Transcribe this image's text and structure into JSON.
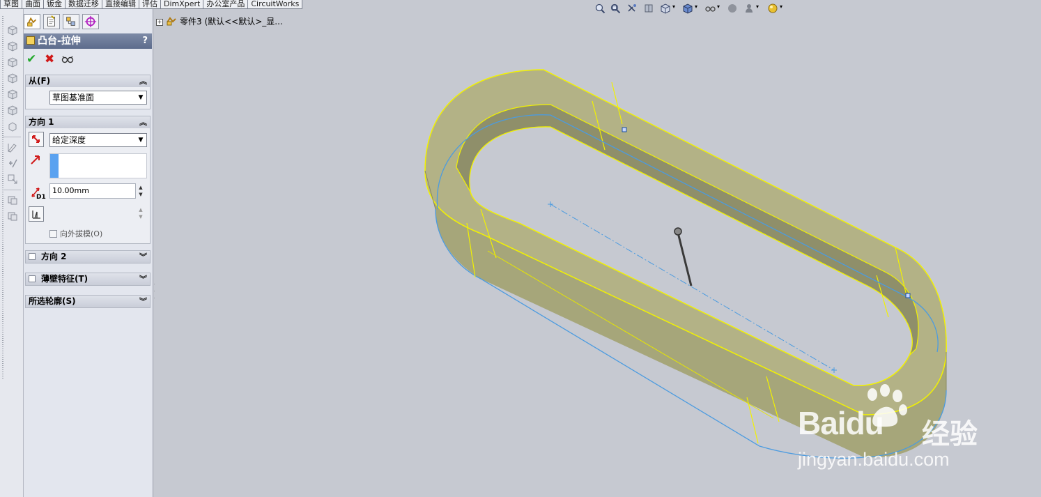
{
  "command_tabs": [
    "草图",
    "曲面",
    "钣金",
    "数据迁移",
    "直接编辑",
    "评估",
    "DimXpert",
    "办公室产品",
    "CircuitWorks"
  ],
  "property_manager": {
    "title": "凸台-拉伸",
    "help": "?",
    "from_group": {
      "header": "从(F)",
      "start_condition": "草图基准面"
    },
    "direction1_group": {
      "header": "方向 1",
      "end_condition": "给定深度",
      "depth": "10.00mm",
      "depth_label": "D1",
      "draft_outward_label": "向外拔模(O)"
    },
    "direction2_group": {
      "header": "方向 2"
    },
    "thin_feature_group": {
      "header": "薄壁特征(T)"
    },
    "selected_contours_group": {
      "header": "所选轮廓(S)"
    }
  },
  "feature_tree": {
    "root_label": "零件3  (默认<<默认>_显..."
  },
  "watermark": {
    "logo": "Baidu",
    "cn": "经验",
    "url": "jingyan.baidu.com"
  },
  "colors": {
    "model_face": "#aaa97a",
    "model_edge": "#f2f200",
    "sketch_line": "#4b9be0",
    "viewport_bg": "#c6c9d1",
    "title_bar": "#6a7898"
  },
  "icons": [
    "zoom-to-fit-icon",
    "zoom-area-icon",
    "previous-view-icon",
    "section-view-icon",
    "view-orientation-icon",
    "display-style-icon",
    "hide-show-icon",
    "edit-appearance-icon",
    "apply-scene-icon",
    "view-settings-icon"
  ]
}
